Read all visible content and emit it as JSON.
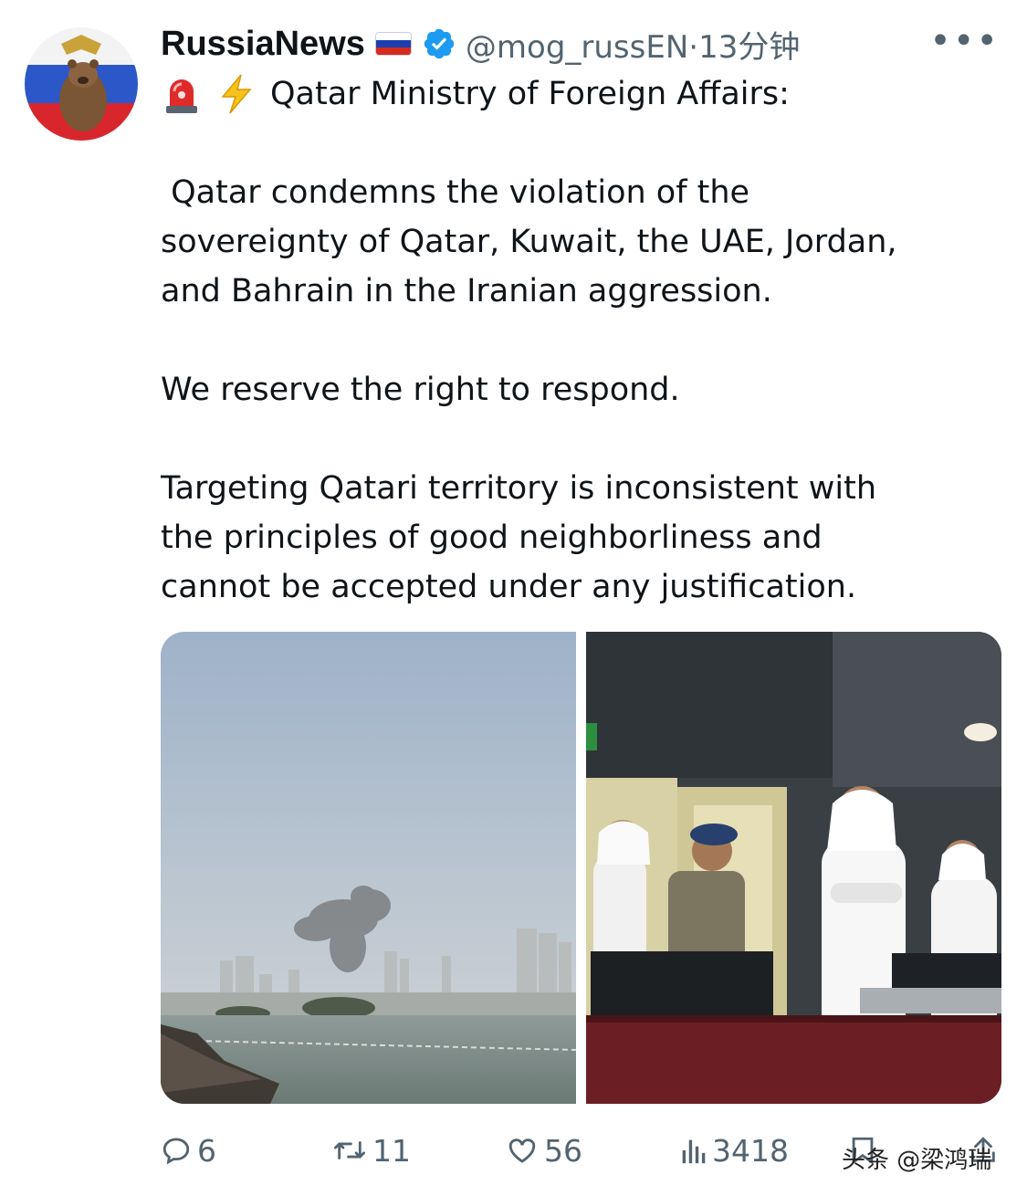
{
  "tweet": {
    "display_name": "RussiaNews",
    "handle_time": "@mog_russEN·13分钟",
    "more_label": "•••",
    "first_line": "Qatar Ministry of Foreign Affairs:",
    "paragraph1_line1": " Qatar condemns the violation of the",
    "paragraph1_line2": "sovereignty of Qatar, Kuwait, the UAE, Jordan,",
    "paragraph1_line3": "and Bahrain in the Iranian aggression.",
    "paragraph2": "We reserve the right to respond.",
    "paragraph3_line1": "Targeting Qatari territory is inconsistent with",
    "paragraph3_line2": "the principles of good neighborliness and",
    "paragraph3_line3": "cannot be accepted under any justification."
  },
  "actions": {
    "replies": "6",
    "reposts": "11",
    "likes": "56",
    "views": "3418"
  },
  "watermark": "头条 @梁鸿瑞",
  "colors": {
    "text": "#0f1419",
    "secondary": "#536471",
    "verified": "#1d9bf0"
  },
  "icons": [
    "rotating-light-icon",
    "lightning-icon",
    "verified-badge-icon",
    "reply-icon",
    "repost-icon",
    "like-icon",
    "views-icon",
    "bookmark-icon",
    "share-icon"
  ]
}
